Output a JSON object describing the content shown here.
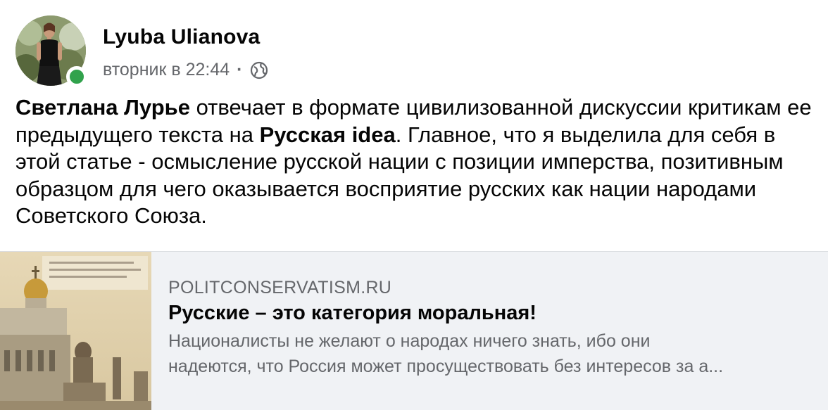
{
  "author": {
    "name": "Lyuba Ulianova",
    "timestamp": "вторник в 22:44",
    "separator": "·",
    "privacy_icon": "globe-icon",
    "online": true
  },
  "post": {
    "mention_1": "Светлана Лурье",
    "text_1": " отвечает в формате цивилизованной дискуссии критикам ее предыдущего текста на ",
    "mention_2": "Русская idea",
    "text_2": ". Главное, что я выделила для себя в этой статье - осмысление русской нации с позиции имперства, позитивным образцом для чего оказывается восприятие русских как нации народами Советского Союза."
  },
  "link_preview": {
    "domain": "POLITCONSERVATISM.RU",
    "title": "Русские – это категория моральная!",
    "description_line_1": "Националисты не желают о народах ничего знать, ибо они",
    "description_line_2": "надеются, что Россия может просуществовать без интересов за а..."
  },
  "colors": {
    "online": "#31a24c",
    "secondary_text": "#65676b",
    "card_bg": "#f0f2f5"
  }
}
